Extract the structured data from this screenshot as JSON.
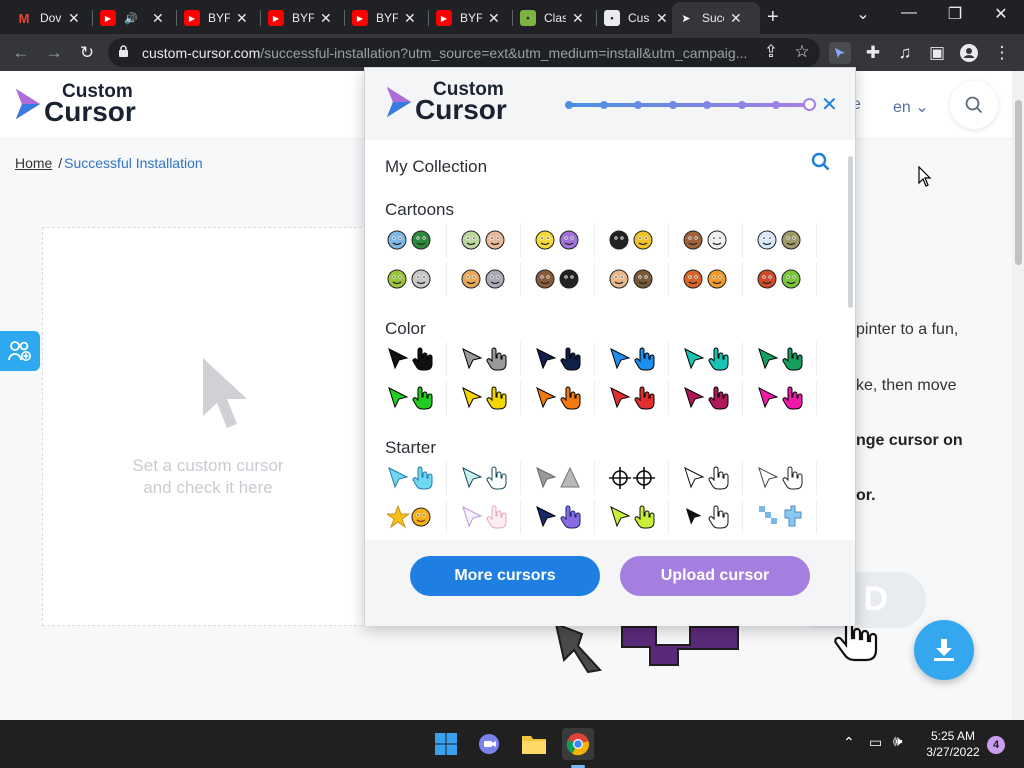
{
  "browser": {
    "tabs": [
      {
        "title": "Dov",
        "icon": "gmail-icon",
        "color": "#ea4335"
      },
      {
        "title": "",
        "icon": "youtube-icon",
        "color": "#ff0000",
        "audio": true
      },
      {
        "title": "BYF",
        "icon": "youtube-icon",
        "color": "#ff0000"
      },
      {
        "title": "BYF",
        "icon": "youtube-icon",
        "color": "#ff0000"
      },
      {
        "title": "BYF",
        "icon": "youtube-icon",
        "color": "#ff0000"
      },
      {
        "title": "BYF",
        "icon": "youtube-icon",
        "color": "#ff0000"
      },
      {
        "title": "Clas",
        "icon": "app-icon",
        "color": "#7cb342"
      },
      {
        "title": "Cus",
        "icon": "chrome-store-icon",
        "color": "#e8eaed"
      },
      {
        "title": "Succ",
        "icon": "cursor-icon",
        "color": "#ffffff",
        "active": true
      }
    ],
    "url_domain": "custom-cursor.com",
    "url_path": "/successful-installation?utm_source=ext&utm_medium=install&utm_campaig..."
  },
  "site": {
    "logo_line1": "Custom",
    "logo_line2": "Cursor",
    "nav_partial": "e",
    "language": "en",
    "breadcrumb": {
      "home": "Home",
      "separator": "/",
      "current": "Successful Installation"
    },
    "test_area_line1": "Set a custom cursor",
    "test_area_line2": "and check it here",
    "text_lines": [
      {
        "text": "pinter to a fun,",
        "bold": false
      },
      {
        "text": "ke, then move",
        "bold": false
      },
      {
        "text": "nge cursor on",
        "bold": true
      },
      {
        "text": "or.",
        "bold": true
      }
    ],
    "cta_partial": "D"
  },
  "popup": {
    "logo_line1": "Custom",
    "logo_line2": "Cursor",
    "progress_steps": 8,
    "progress_current": 8,
    "collection_title": "My Collection",
    "categories": [
      {
        "title": "Cartoons",
        "items": [
          "sword-turtle",
          "dog-sailor",
          "minions",
          "felix-cheese",
          "bears",
          "bird-sword",
          "shrek-donkey",
          "tom-jerry",
          "boy-dragon",
          "ben10",
          "garfield",
          "squirrel-grinch"
        ]
      },
      {
        "title": "Color",
        "items": [
          "#111111",
          "#9a9a9a",
          "#10204a",
          "#1e8ff0",
          "#18c5b4",
          "#16a060",
          "#22cc22",
          "#f2d600",
          "#f07a10",
          "#e23030",
          "#b0185a",
          "#ee1aa8"
        ]
      },
      {
        "title": "Starter",
        "items": [
          "cyan-pointer",
          "teal-outline",
          "grey-triangle",
          "crosshair",
          "black-outline",
          "hand-outline",
          "smiley-star",
          "pastel-pointer",
          "purple-hand",
          "lime-pointer",
          "black-white",
          "blue-pixel"
        ]
      }
    ],
    "more_button": "More cursors",
    "upload_button": "Upload cursor"
  },
  "taskbar": {
    "time": "5:25 AM",
    "date": "3/27/2022",
    "notification_count": "4"
  }
}
